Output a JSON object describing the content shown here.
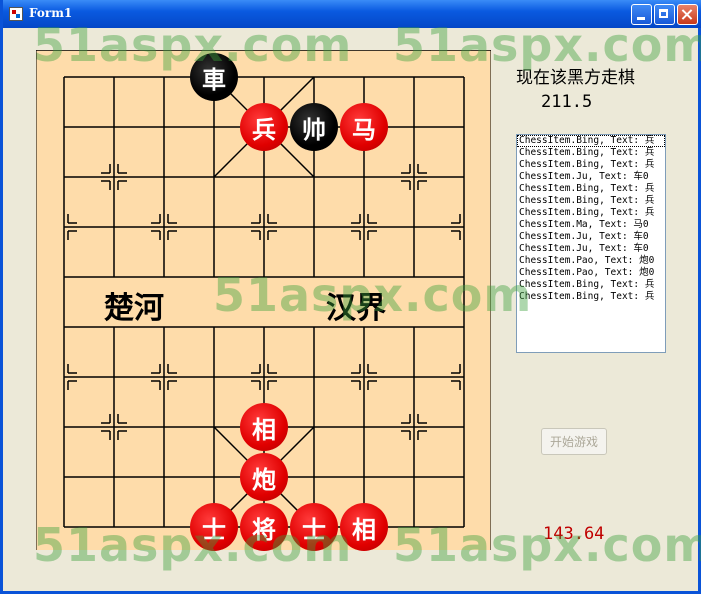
{
  "window": {
    "title": "Form1"
  },
  "board": {
    "river_left": "楚河",
    "river_right": "汉界",
    "pieces": [
      {
        "char": "車",
        "side": "black"
      },
      {
        "char": "兵",
        "side": "red"
      },
      {
        "char": "帅",
        "side": "black"
      },
      {
        "char": "马",
        "side": "red"
      },
      {
        "char": "相",
        "side": "red"
      },
      {
        "char": "炮",
        "side": "red"
      },
      {
        "char": "士",
        "side": "red"
      },
      {
        "char": "将",
        "side": "red"
      },
      {
        "char": "士",
        "side": "red"
      },
      {
        "char": "相",
        "side": "red"
      }
    ]
  },
  "status_text": "现在该黑方走棋",
  "timer_top": "211.5",
  "log_items": [
    "ChessItem.Bing, Text: 兵",
    "ChessItem.Bing, Text: 兵",
    "ChessItem.Bing, Text: 兵",
    "ChessItem.Ju, Text: 车0",
    "ChessItem.Bing, Text: 兵",
    "ChessItem.Bing, Text: 兵",
    "ChessItem.Bing, Text: 兵",
    "ChessItem.Ma, Text: 马0",
    "ChessItem.Ju, Text: 车0",
    "ChessItem.Ju, Text: 车0",
    "ChessItem.Pao, Text: 炮0",
    "ChessItem.Pao, Text: 炮0",
    "ChessItem.Bing, Text: 兵",
    "ChessItem.Bing, Text: 兵"
  ],
  "start_button": "开始游戏",
  "timer_bottom": "143.64",
  "watermark": "51aspx.com",
  "colors": {
    "board": "#fedcaa",
    "red_piece": "#e00000",
    "black_piece": "#000000",
    "timer_bottom": "#c00000",
    "titlebar": "#0a5ae0"
  }
}
